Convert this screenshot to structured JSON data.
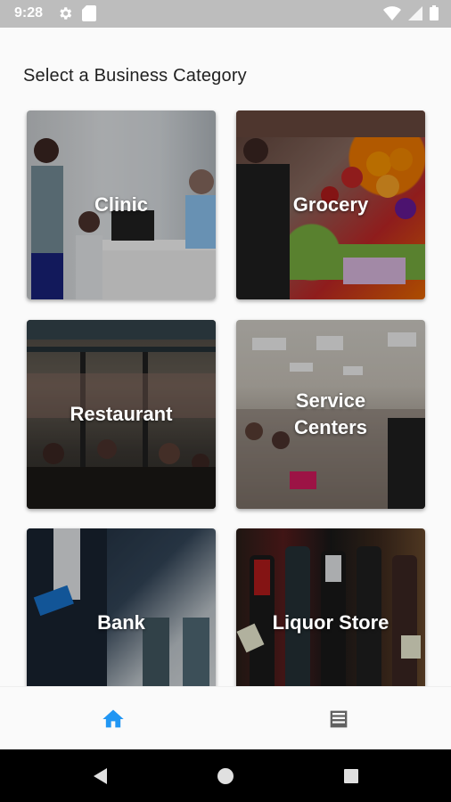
{
  "status_bar": {
    "time": "9:28",
    "left_icons": [
      "gear-icon",
      "sd-card-icon"
    ],
    "right_icons": [
      "wifi-icon",
      "signal-icon",
      "battery-icon"
    ]
  },
  "page": {
    "title": "Select a Business Category"
  },
  "categories": [
    {
      "label": "Clinic"
    },
    {
      "label": "Grocery"
    },
    {
      "label": "Restaurant"
    },
    {
      "label": "Service Centers"
    },
    {
      "label": "Bank"
    },
    {
      "label": "Liquor Store"
    }
  ],
  "bottom_nav": {
    "items": [
      {
        "icon": "home-icon",
        "active": true
      },
      {
        "icon": "list-icon",
        "active": false
      }
    ]
  },
  "colors": {
    "accent": "#2196f3",
    "inactive": "#616161",
    "status_bar": "#bdbdbd"
  }
}
